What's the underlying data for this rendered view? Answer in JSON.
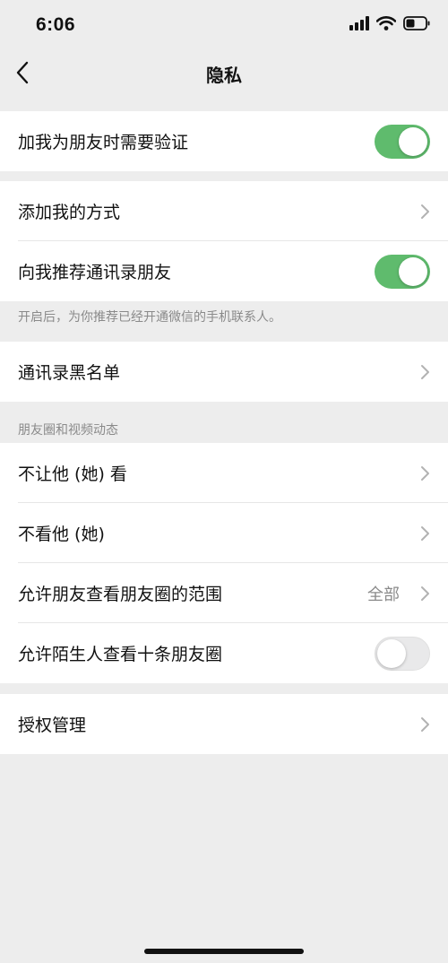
{
  "status_bar": {
    "time": "6:06",
    "icons": [
      "cellular-signal-icon",
      "wifi-icon",
      "battery-icon"
    ]
  },
  "nav": {
    "title": "隐私",
    "back_icon": "chevron-left-icon"
  },
  "groups": {
    "verify": {
      "label": "加我为朋友时需要验证",
      "toggle_on": true
    },
    "contact": {
      "add_me_label": "添加我的方式",
      "recommend_label": "向我推荐通讯录朋友",
      "recommend_toggle_on": true,
      "note": "开启后，为你推荐已经开通微信的手机联系人。"
    },
    "blacklist": {
      "label": "通讯录黑名单"
    },
    "moments": {
      "header": "朋友圈和视频动态",
      "hide_from_label": "不让他 (她) 看",
      "not_see_label": "不看他 (她)",
      "range_label": "允许朋友查看朋友圈的范围",
      "range_value": "全部",
      "stranger_label": "允许陌生人查看十条朋友圈",
      "stranger_toggle_on": false
    },
    "auth": {
      "label": "授权管理"
    }
  },
  "colors": {
    "toggle_on": "#5fbb6d",
    "background": "#ededed",
    "secondary_text": "#8a8a8a"
  }
}
